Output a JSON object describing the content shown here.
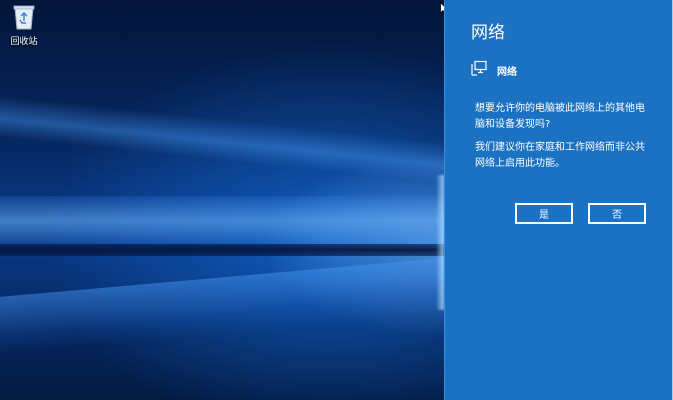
{
  "desktop": {
    "recycle_bin": {
      "label": "回收站",
      "icon": "recycle-bin-icon"
    }
  },
  "network_panel": {
    "title": "网络",
    "network": {
      "icon": "network-monitor-icon",
      "label": "网络"
    },
    "question": "想要允许你的电脑被此网络上的其他电脑和设备发现吗?",
    "advice": "我们建议你在家庭和工作网络而非公共网络上启用此功能。",
    "yes_label": "是",
    "no_label": "否"
  },
  "colors": {
    "panel_background": "#1b72c3",
    "text": "#ffffff"
  }
}
